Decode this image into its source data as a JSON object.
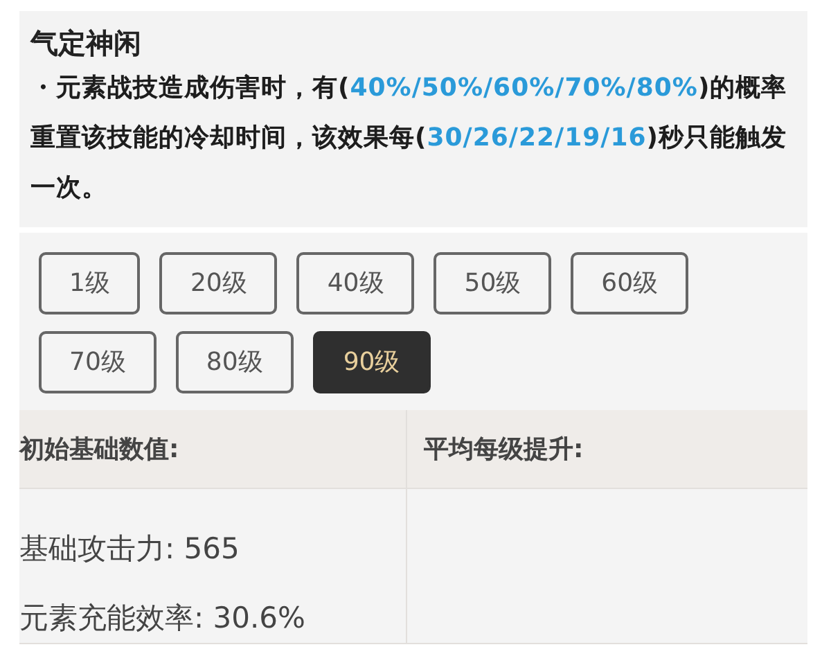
{
  "skill": {
    "title": "气定神闲",
    "description": [
      {
        "text": "・元素战技造成伤害时，有(",
        "highlight": false
      },
      {
        "text": "40%/50%/60%/70%/80%",
        "highlight": true
      },
      {
        "text": ")的概率重置该技能的冷却时间，该效果每(",
        "highlight": false
      },
      {
        "text": "30/26/22/19/16",
        "highlight": true
      },
      {
        "text": ")秒只能触发一次。",
        "highlight": false
      }
    ]
  },
  "levels": [
    {
      "label": "1级",
      "selected": false
    },
    {
      "label": "20级",
      "selected": false
    },
    {
      "label": "40级",
      "selected": false
    },
    {
      "label": "50级",
      "selected": false
    },
    {
      "label": "60级",
      "selected": false
    },
    {
      "label": "70级",
      "selected": false
    },
    {
      "label": "80级",
      "selected": false
    },
    {
      "label": "90级",
      "selected": true
    }
  ],
  "stats": {
    "base": {
      "header": "初始基础数值:",
      "values": [
        "基础攻击力: 565",
        "元素充能效率: 30.6%"
      ]
    },
    "growth": {
      "header": "平均每级提升:"
    }
  }
}
